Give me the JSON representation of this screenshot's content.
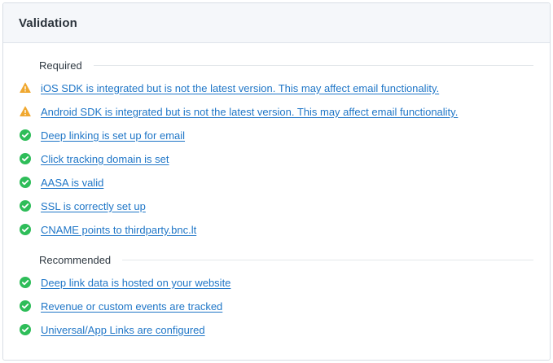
{
  "panel": {
    "title": "Validation"
  },
  "colors": {
    "link": "#1f76c7",
    "success": "#2ebd59",
    "warning": "#f0a830"
  },
  "required": {
    "label": "Required",
    "items": [
      {
        "status": "warning",
        "icon": "warning-icon",
        "text": "iOS SDK is integrated but is not the latest version. This may affect email functionality."
      },
      {
        "status": "warning",
        "icon": "warning-icon",
        "text": "Android SDK is integrated but is not the latest version. This may affect email functionality."
      },
      {
        "status": "success",
        "icon": "check-circle-icon",
        "text": "Deep linking is set up for email"
      },
      {
        "status": "success",
        "icon": "check-circle-icon",
        "text": "Click tracking domain is set"
      },
      {
        "status": "success",
        "icon": "check-circle-icon",
        "text": "AASA is valid"
      },
      {
        "status": "success",
        "icon": "check-circle-icon",
        "text": "SSL is correctly set up"
      },
      {
        "status": "success",
        "icon": "check-circle-icon",
        "text": "CNAME points to thirdparty.bnc.lt"
      }
    ]
  },
  "recommended": {
    "label": "Recommended",
    "items": [
      {
        "status": "success",
        "icon": "check-circle-icon",
        "text": "Deep link data is hosted on your website"
      },
      {
        "status": "success",
        "icon": "check-circle-icon",
        "text": "Revenue or custom events are tracked"
      },
      {
        "status": "success",
        "icon": "check-circle-icon",
        "text": "Universal/App Links are configured"
      }
    ]
  }
}
